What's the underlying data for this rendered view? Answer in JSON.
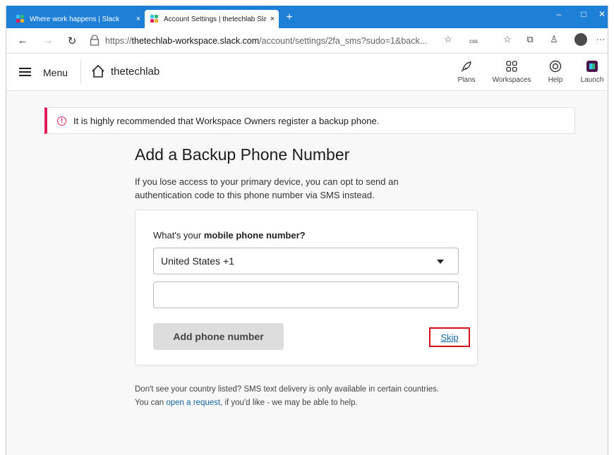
{
  "browser": {
    "tabs": [
      {
        "title": "Where work happens | Slack",
        "close": "×"
      },
      {
        "title": "Account Settings | thetechlab Sla",
        "close": "×"
      }
    ],
    "new_tab": "+",
    "window_controls": {
      "minimize": "–",
      "maximize": "□",
      "close": "✕"
    },
    "nav": {
      "back": "←",
      "forward": "→",
      "reload": "↻"
    },
    "url": {
      "scheme": "https://",
      "host": "thetechlab-workspace.slack.com",
      "path": "/account/settings/2fa_sms?sudo=1&back..."
    },
    "toolbar": {
      "favorite": "☆",
      "css": "css",
      "favorites": "☆",
      "collections": "⧉",
      "profile": "♙",
      "more": "···"
    }
  },
  "slack_nav": {
    "menu_label": "Menu",
    "workspace_name": "thetechlab",
    "items": [
      {
        "label": "Plans",
        "icon": "rocket-icon"
      },
      {
        "label": "Workspaces",
        "icon": "grid-icon"
      },
      {
        "label": "Help",
        "icon": "help-ring-icon"
      },
      {
        "label": "Launch",
        "icon": "slack-launch-icon"
      }
    ]
  },
  "banner": {
    "text": "It is highly recommended that Workspace Owners register a backup phone.",
    "icon": "!"
  },
  "page": {
    "title": "Add a Backup Phone Number",
    "intro_line1": "If you lose access to your primary device, you can opt to send an",
    "intro_line2": "authentication code to this phone number via SMS instead."
  },
  "form": {
    "question_prefix": "What's your ",
    "question_bold": "mobile phone number?",
    "country_value": "United States +1",
    "phone_value": "",
    "add_button": "Add phone number",
    "skip_link": "Skip"
  },
  "footnote": {
    "line1": "Don't see your country listed? SMS text delivery is only available in certain countries.",
    "line2_prefix": "You can ",
    "line2_link": "open a request",
    "line2_suffix": ", if you'd like - we may be able to help."
  },
  "colors": {
    "tab_strip": "#1e7fd6",
    "accent_red": "#e01e5a",
    "link_blue": "#1264a3",
    "highlight_box": "#d0101a"
  }
}
